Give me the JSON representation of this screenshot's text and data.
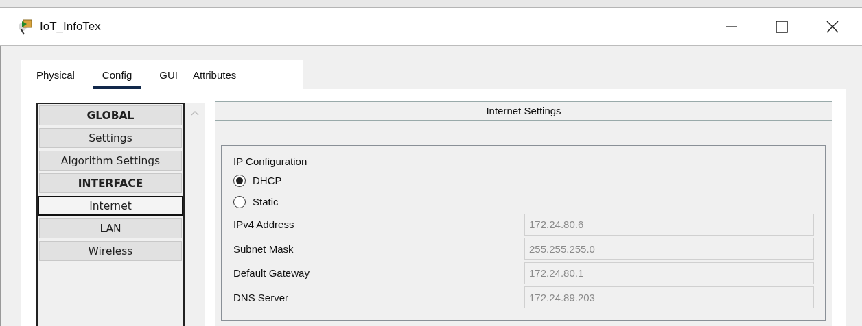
{
  "window": {
    "title": "IoT_InfoTex"
  },
  "tabs": [
    {
      "label": "Physical",
      "selected": false
    },
    {
      "label": "Config",
      "selected": true
    },
    {
      "label": "GUI",
      "selected": false
    },
    {
      "label": "Attributes",
      "selected": false
    }
  ],
  "sidebar": {
    "items": [
      {
        "label": "GLOBAL",
        "kind": "header",
        "selected": false
      },
      {
        "label": "Settings",
        "kind": "item",
        "selected": false
      },
      {
        "label": "Algorithm Settings",
        "kind": "item",
        "selected": false
      },
      {
        "label": "INTERFACE",
        "kind": "header",
        "selected": false
      },
      {
        "label": "Internet",
        "kind": "item",
        "selected": true
      },
      {
        "label": "LAN",
        "kind": "item",
        "selected": false
      },
      {
        "label": "Wireless",
        "kind": "item",
        "selected": false
      }
    ]
  },
  "panel": {
    "title": "Internet Settings",
    "group_label": "IP Configuration",
    "options": [
      {
        "label": "DHCP",
        "selected": true
      },
      {
        "label": "Static",
        "selected": false
      }
    ],
    "fields": [
      {
        "label": "IPv4 Address",
        "value": "172.24.80.6",
        "disabled": true
      },
      {
        "label": "Subnet Mask",
        "value": "255.255.255.0",
        "disabled": true
      },
      {
        "label": "Default Gateway",
        "value": "172.24.80.1",
        "disabled": true
      },
      {
        "label": "DNS Server",
        "value": "172.24.89.203",
        "disabled": true
      }
    ]
  }
}
